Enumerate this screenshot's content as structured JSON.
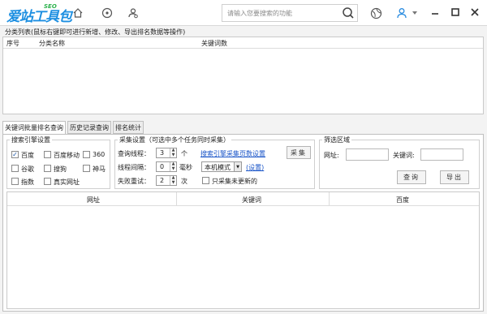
{
  "app": {
    "logo_text": "爱站工具包",
    "logo_badge": "SEO"
  },
  "toolbar": {
    "icons": [
      "home-icon",
      "record-icon",
      "user-gear-icon"
    ]
  },
  "search": {
    "placeholder": "请输入您要搜索的功能"
  },
  "window": {
    "icons": [
      "skin-icon",
      "user-icon",
      "minimize-icon",
      "maximize-icon",
      "close-icon"
    ]
  },
  "category": {
    "title": "分类列表(鼠标右键即可进行新增、修改、导出排名数据等操作)",
    "columns": [
      "序号",
      "分类名称",
      "关键词数"
    ]
  },
  "tabs": [
    {
      "label": "关键词批量排名查询",
      "active": true
    },
    {
      "label": "历史记录查询",
      "active": false
    },
    {
      "label": "排名统计",
      "active": false
    }
  ],
  "engines": {
    "legend": "搜索引擎设置",
    "items": [
      {
        "label": "百度",
        "checked": true
      },
      {
        "label": "百度移动",
        "checked": false
      },
      {
        "label": "360",
        "checked": false
      },
      {
        "label": "谷歌",
        "checked": false
      },
      {
        "label": "搜狗",
        "checked": false
      },
      {
        "label": "神马",
        "checked": false
      },
      {
        "label": "指数",
        "checked": false
      },
      {
        "label": "真实网址",
        "checked": false
      }
    ]
  },
  "collect": {
    "legend": "采集设置（可选中多个任务同时采集）",
    "query_threads_label": "查询线程：",
    "query_threads_value": "3",
    "query_threads_unit": "个",
    "interval_label": "线程间隔：",
    "interval_value": "0",
    "interval_unit": "毫秒",
    "retry_label": "失败重试：",
    "retry_value": "2",
    "retry_unit": "次",
    "pages_link": "搜索引擎采集页数设置",
    "mode_value": "本机模式",
    "settings_link": "(设置)",
    "only_unupdated_label": "只采集未更新的",
    "collect_button": "采集"
  },
  "filter": {
    "legend": "筛选区域",
    "url_label": "网址:",
    "keyword_label": "关键词:",
    "query_button": "查询",
    "export_button": "导出"
  },
  "results": {
    "columns": [
      "网址",
      "关键词",
      "百度"
    ]
  }
}
